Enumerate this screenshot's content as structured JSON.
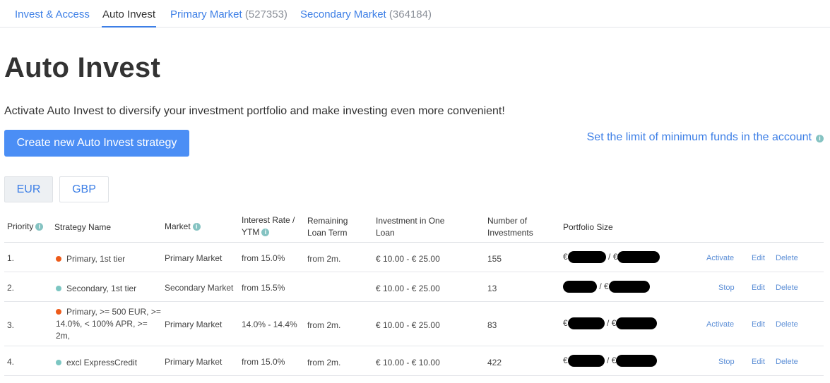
{
  "tabs": [
    {
      "label": "Invest & Access",
      "count": ""
    },
    {
      "label": "Auto Invest",
      "count": ""
    },
    {
      "label": "Primary Market",
      "count": "(527353)"
    },
    {
      "label": "Secondary Market",
      "count": "(364184)"
    }
  ],
  "page": {
    "title": "Auto Invest",
    "subtitle": "Activate Auto Invest to diversify your investment portfolio and make investing even more convenient!",
    "create_button": "Create new Auto Invest strategy",
    "limit_link": "Set the limit of minimum funds in the account",
    "info_glyph": "i"
  },
  "currencies": [
    "EUR",
    "GBP"
  ],
  "table": {
    "headers": {
      "priority": "Priority",
      "strategy_name": "Strategy Name",
      "market": "Market",
      "interest_rate": "Interest Rate /",
      "ytm": "YTM",
      "remaining_loan_term_1": "Remaining",
      "remaining_loan_term_2": "Loan Term",
      "investment_one_loan_1": "Investment in One",
      "investment_one_loan_2": "Loan",
      "number_of_investments_1": "Number of",
      "number_of_investments_2": "Investments",
      "portfolio_size": "Portfolio Size"
    },
    "rows": [
      {
        "priority": "1.",
        "status_color": "#ed5b1a",
        "name": "Primary, 1st tier",
        "market": "Primary Market",
        "interest": "from 15.0%",
        "term": "from 2m.",
        "investment": "€ 10.00 - € 25.00",
        "count": "155",
        "portfolio_prefix": "€",
        "portfolio_sep": "/ €",
        "actions": [
          "Activate",
          "Edit",
          "Delete"
        ]
      },
      {
        "priority": "2.",
        "status_color": "#7cc6c2",
        "name": "Secondary, 1st tier",
        "market": "Secondary Market",
        "interest": "from 15.5%",
        "term": "",
        "investment": "€ 10.00 - € 25.00",
        "count": "13",
        "portfolio_prefix": "",
        "portfolio_sep": "/ €",
        "actions": [
          "Stop",
          "Edit",
          "Delete"
        ]
      },
      {
        "priority": "3.",
        "status_color": "#ed5b1a",
        "name": "Primary, >= 500 EUR, >= 14.0%, < 100% APR, >= 2m,",
        "market": "Primary Market",
        "interest": "14.0% - 14.4%",
        "term": "from 2m.",
        "investment": "€ 10.00 - € 25.00",
        "count": "83",
        "portfolio_prefix": "€",
        "portfolio_sep": "/ €",
        "actions": [
          "Activate",
          "Edit",
          "Delete"
        ]
      },
      {
        "priority": "4.",
        "status_color": "#7cc6c2",
        "name": "excl ExpressCredit",
        "market": "Primary Market",
        "interest": "from 15.0%",
        "term": "from 2m.",
        "investment": "€ 10.00 - € 10.00",
        "count": "422",
        "portfolio_prefix": "€",
        "portfolio_sep": "/ €",
        "actions": [
          "Stop",
          "Edit",
          "Delete"
        ]
      }
    ]
  },
  "colors": {
    "accent": "#3d7fe6",
    "button": "#4b8ef5",
    "info": "#85c3c2"
  },
  "icons": [
    "info-icon",
    "status-dot-icon"
  ]
}
